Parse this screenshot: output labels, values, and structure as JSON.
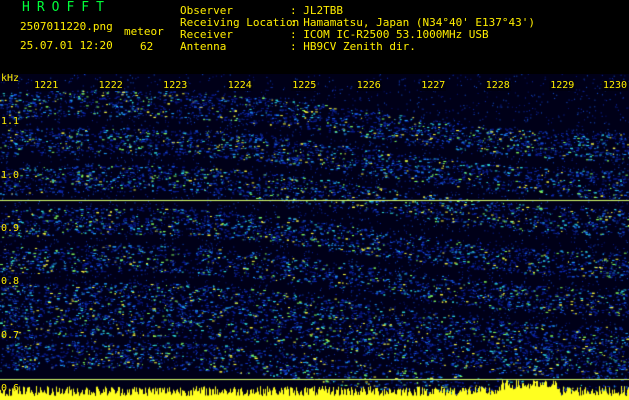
{
  "header": {
    "app_title": "HROFFT",
    "file_name": "2507011220.png",
    "datetime": "25.07.01 12:20",
    "meteor_label": "meteor",
    "meteor_count": "62",
    "info": [
      {
        "label": "Observer",
        "value": ": JL2TBB"
      },
      {
        "label": "Receiving Location",
        "value": ": Hamamatsu, Japan (N34°40' E137°43')"
      },
      {
        "label": "Receiver",
        "value": ": ICOM IC-R2500 53.1000MHz USB"
      },
      {
        "label": "Antenna",
        "value": ": HB9CV Zenith dir."
      }
    ]
  },
  "chart_data": {
    "type": "heatmap",
    "ylabel": "kHz",
    "ylim": [
      0.58,
      1.19
    ],
    "y_ticks": [
      "1.1",
      "1.0",
      "0.9",
      "0.8",
      "0.7",
      "0.6"
    ],
    "y_tick_values": [
      1.1,
      1.0,
      0.9,
      0.8,
      0.7,
      0.6
    ],
    "x_ticks": [
      "1221",
      "1222",
      "1223",
      "1224",
      "1225",
      "1226",
      "1227",
      "1228",
      "1229",
      "1230"
    ],
    "x_tick_values": [
      1221,
      1222,
      1223,
      1224,
      1225,
      1226,
      1227,
      1228,
      1229,
      1230
    ],
    "xlim": [
      1220.3,
      1230.05
    ],
    "carrier_lines_khz": [
      0.955,
      0.62
    ],
    "colors": {
      "background": "#000018",
      "label": "#ffee00",
      "title": "#00ff3a",
      "carrier": "#d8ff6a"
    }
  }
}
